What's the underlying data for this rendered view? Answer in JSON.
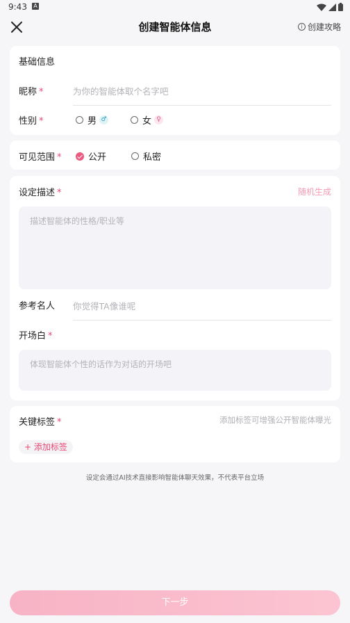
{
  "status_bar": {
    "time": "9:43",
    "notif_glyph": "A"
  },
  "header": {
    "title": "创建智能体信息",
    "guide_label": "创建攻略",
    "info_glyph": "i"
  },
  "basic_info": {
    "section_title": "基础信息",
    "nickname_label": "昵称",
    "nickname_placeholder": "为你的智能体取个名字吧",
    "gender_label": "性别",
    "gender_options": [
      "男",
      "女"
    ],
    "male_symbol": "♂",
    "female_symbol": "♀"
  },
  "visibility": {
    "label": "可见范围",
    "options": [
      "公开",
      "私密"
    ],
    "selected": "公开"
  },
  "setting": {
    "description_label": "设定描述",
    "random_generate": "随机生成",
    "description_placeholder": "描述智能体的性格/职业等",
    "reference_label": "参考名人",
    "reference_placeholder": "你觉得TA像谁呢",
    "opening_label": "开场白",
    "opening_placeholder": "体现智能体个性的话作为对话的开场吧"
  },
  "tags": {
    "label": "关键标签",
    "hint": "添加标签可增强公开智能体曝光",
    "add_tag": "+ 添加标签"
  },
  "required_mark": "*",
  "disclaimer": "设定会通过AI技术直接影响智能体聊天效果，不代表平台立场",
  "next_button": "下一步",
  "colors": {
    "accent": "#e94873",
    "button_start": "#f7b3c5",
    "button_end": "#fcc4d2"
  }
}
